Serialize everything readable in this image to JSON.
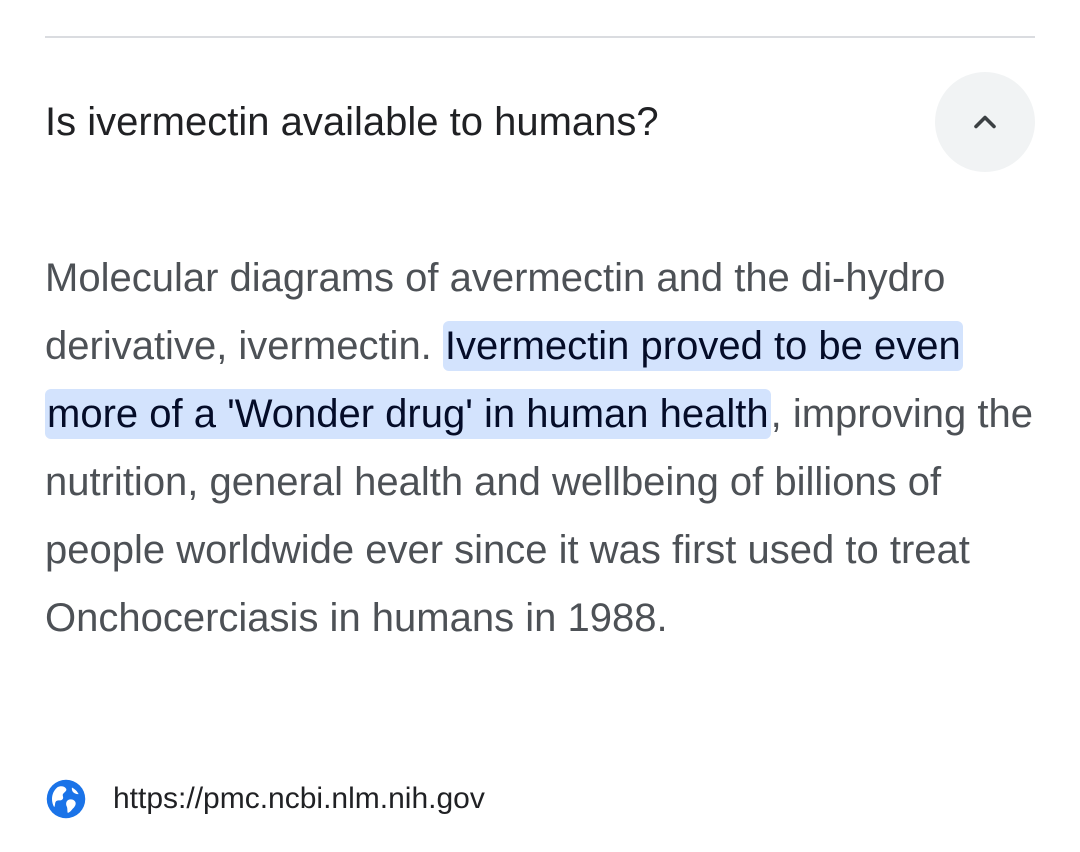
{
  "faq": {
    "question": "Is ivermectin available to humans?",
    "toggle_icon": "chevron-up-icon",
    "answer": {
      "before": "Molecular diagrams of avermectin and the di-hydro derivative, ivermectin. ",
      "highlight": "Ivermectin proved to be even more of a 'Wonder drug' in human health",
      "after": ", improving the nutrition, general health and wellbeing of billions of people worldwide ever since it was first used to treat Onchocerciasis in humans in 1988."
    },
    "source": {
      "icon": "globe-icon",
      "url": "https://pmc.ncbi.nlm.nih.gov"
    }
  },
  "colors": {
    "highlight_background": "#d3e3fd",
    "highlight_text": "#040c28",
    "body_text": "#4d5156",
    "title_text": "#202124",
    "toggle_background": "#f1f3f4",
    "globe_blue": "#1a73e8"
  }
}
